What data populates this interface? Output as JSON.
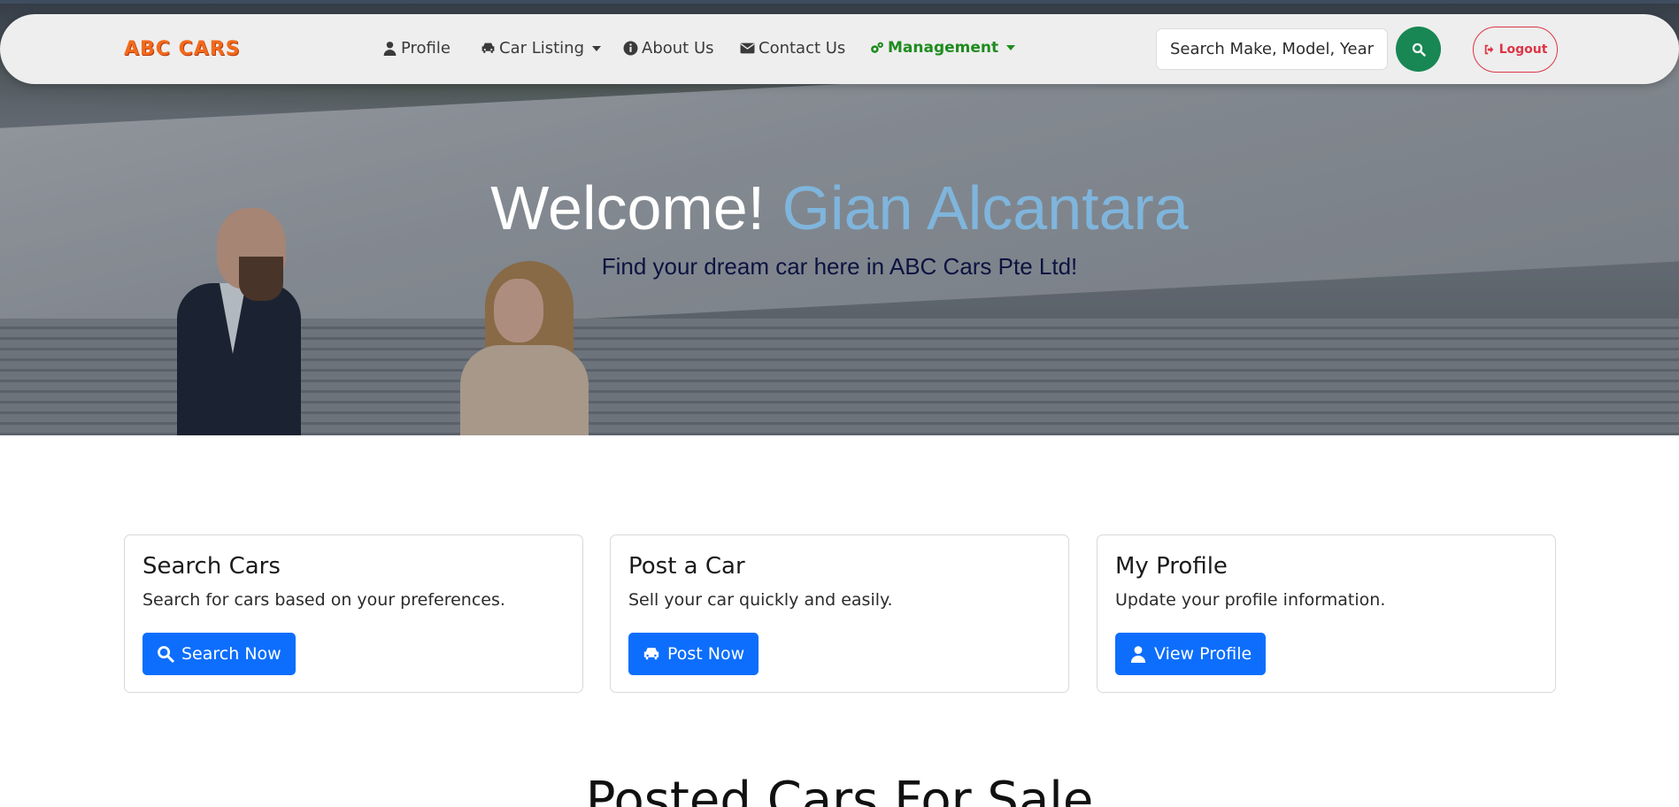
{
  "navbar": {
    "brand": "ABC CARS",
    "items": [
      {
        "label": "Profile",
        "icon": "user-icon"
      },
      {
        "label": "Car Listing",
        "icon": "car-icon",
        "dropdown": true
      },
      {
        "label": "About Us",
        "icon": "info-circle-icon"
      },
      {
        "label": "Contact Us",
        "icon": "envelope-icon"
      },
      {
        "label": "Management",
        "icon": "gears-icon",
        "dropdown": true
      }
    ],
    "search_placeholder": "Search Make, Model, Year",
    "logout_label": "Logout"
  },
  "hero": {
    "welcome": "Welcome!",
    "user_name": "Gian Alcantara",
    "tagline": "Find your dream car here in ABC Cars Pte Ltd!"
  },
  "cards": [
    {
      "title": "Search Cars",
      "text": "Search for cars based on your preferences.",
      "button": "Search Now",
      "icon": "search-icon"
    },
    {
      "title": "Post a Car",
      "text": "Sell your car quickly and easily.",
      "button": "Post Now",
      "icon": "car-icon"
    },
    {
      "title": "My Profile",
      "text": "Update your profile information.",
      "button": "View Profile",
      "icon": "user-icon"
    }
  ],
  "section_heading": "Posted Cars For Sale",
  "colors": {
    "brand": "#f26a1b",
    "management": "#1e8c1e",
    "search_button": "#188754",
    "logout": "#dc3545",
    "primary_button": "#0d6efd",
    "welcome_name": "#7fb5dc"
  }
}
